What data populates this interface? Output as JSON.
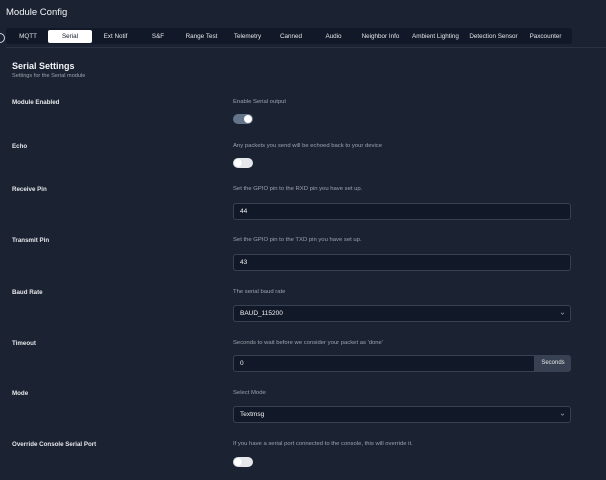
{
  "app": {
    "title": "Module Config"
  },
  "tabs": [
    {
      "label": "MQTT",
      "active": false
    },
    {
      "label": "Serial",
      "active": true
    },
    {
      "label": "Ext Notif",
      "active": false
    },
    {
      "label": "S&F",
      "active": false
    },
    {
      "label": "Range Test",
      "active": false
    },
    {
      "label": "Telemetry",
      "active": false
    },
    {
      "label": "Canned",
      "active": false
    },
    {
      "label": "Audio",
      "active": false
    },
    {
      "label": "Neighbor Info",
      "active": false
    },
    {
      "label": "Ambient Lighting",
      "active": false
    },
    {
      "label": "Detection Sensor",
      "active": false
    },
    {
      "label": "Paxcounter",
      "active": false
    }
  ],
  "section": {
    "title": "Serial Settings",
    "subtitle": "Settings for the Serial module"
  },
  "fields": {
    "module_enabled": {
      "label": "Module Enabled",
      "description": "Enable Serial output",
      "value": true
    },
    "echo": {
      "label": "Echo",
      "description": "Any packets you send will be echoed back to your device",
      "value": false
    },
    "receive_pin": {
      "label": "Receive Pin",
      "description": "Set the GPIO pin to the RXD pin you have set up.",
      "value": "44"
    },
    "transmit_pin": {
      "label": "Transmit Pin",
      "description": "Set the GPIO pin to the TXD pin you have set up.",
      "value": "43"
    },
    "baud_rate": {
      "label": "Baud Rate",
      "description": "The serial baud rate",
      "value": "BAUD_115200"
    },
    "timeout": {
      "label": "Timeout",
      "description": "Seconds to wait before we consider your packet as 'done'",
      "value": "0",
      "suffix": "Seconds"
    },
    "mode": {
      "label": "Mode",
      "description": "Select Mode",
      "value": "Textmsg"
    },
    "override_console": {
      "label": "Override Console Serial Port",
      "description": "If you have a serial port connected to the console, this will override it.",
      "value": false
    }
  },
  "colors": {
    "background": "#1b2231",
    "tab_bar": "#111827",
    "active_tab": "#ffffff",
    "input_bg": "#111827",
    "toggle_on": "#64748b",
    "toggle_off": "#e5e7eb"
  },
  "icons": {
    "select_chevron": "chevron-down-icon"
  }
}
